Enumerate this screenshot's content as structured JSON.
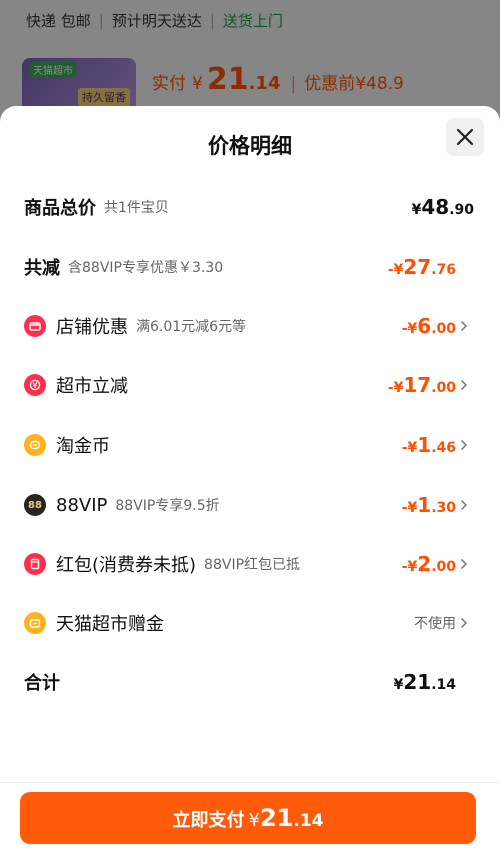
{
  "background": {
    "delivery": "快递 包邮",
    "eta": "预计明天送达",
    "door": "送货上门",
    "thumb_tag": "天猫超市",
    "thumb_badge": "持久留香",
    "actual_label": "实付",
    "yen": "¥",
    "actual_int": "21",
    "actual_dec": ".14",
    "before_label": "优惠前¥48.9"
  },
  "sheet": {
    "title": "价格明细",
    "rows": [
      {
        "label": "商品总价",
        "sub": "共1件宝贝",
        "yen": "¥",
        "int": "48",
        "dec": ".90"
      },
      {
        "label": "共减",
        "sub": "含88VIP专享优惠￥3.30",
        "yen": "-¥",
        "int": "27",
        "dec": ".76"
      },
      {
        "label": "店铺优惠",
        "sub": "满6.01元减6元等",
        "yen": "-¥",
        "int": "6",
        "dec": ".00"
      },
      {
        "label": "超市立减",
        "sub": "",
        "yen": "-¥",
        "int": "17",
        "dec": ".00"
      },
      {
        "label": "淘金币",
        "sub": "",
        "yen": "-¥",
        "int": "1",
        "dec": ".46"
      },
      {
        "label": "88VIP",
        "sub": "88VIP专享9.5折",
        "yen": "-¥",
        "int": "1",
        "dec": ".30"
      },
      {
        "label": "红包(消费券未抵)",
        "sub": "88VIP红包已抵",
        "yen": "-¥",
        "int": "2",
        "dec": ".00"
      },
      {
        "label": "天猫超市赠金",
        "sub": "",
        "value": "不使用"
      },
      {
        "label": "合计",
        "sub": "",
        "yen": "¥",
        "int": "21",
        "dec": ".14"
      }
    ],
    "icon_88_text": "88",
    "pay": {
      "label": "立即支付",
      "yen": "¥",
      "int": "21",
      "dec": ".14"
    }
  },
  "colors": {
    "accent": "#ff5000",
    "button": "#ff5b0a"
  }
}
